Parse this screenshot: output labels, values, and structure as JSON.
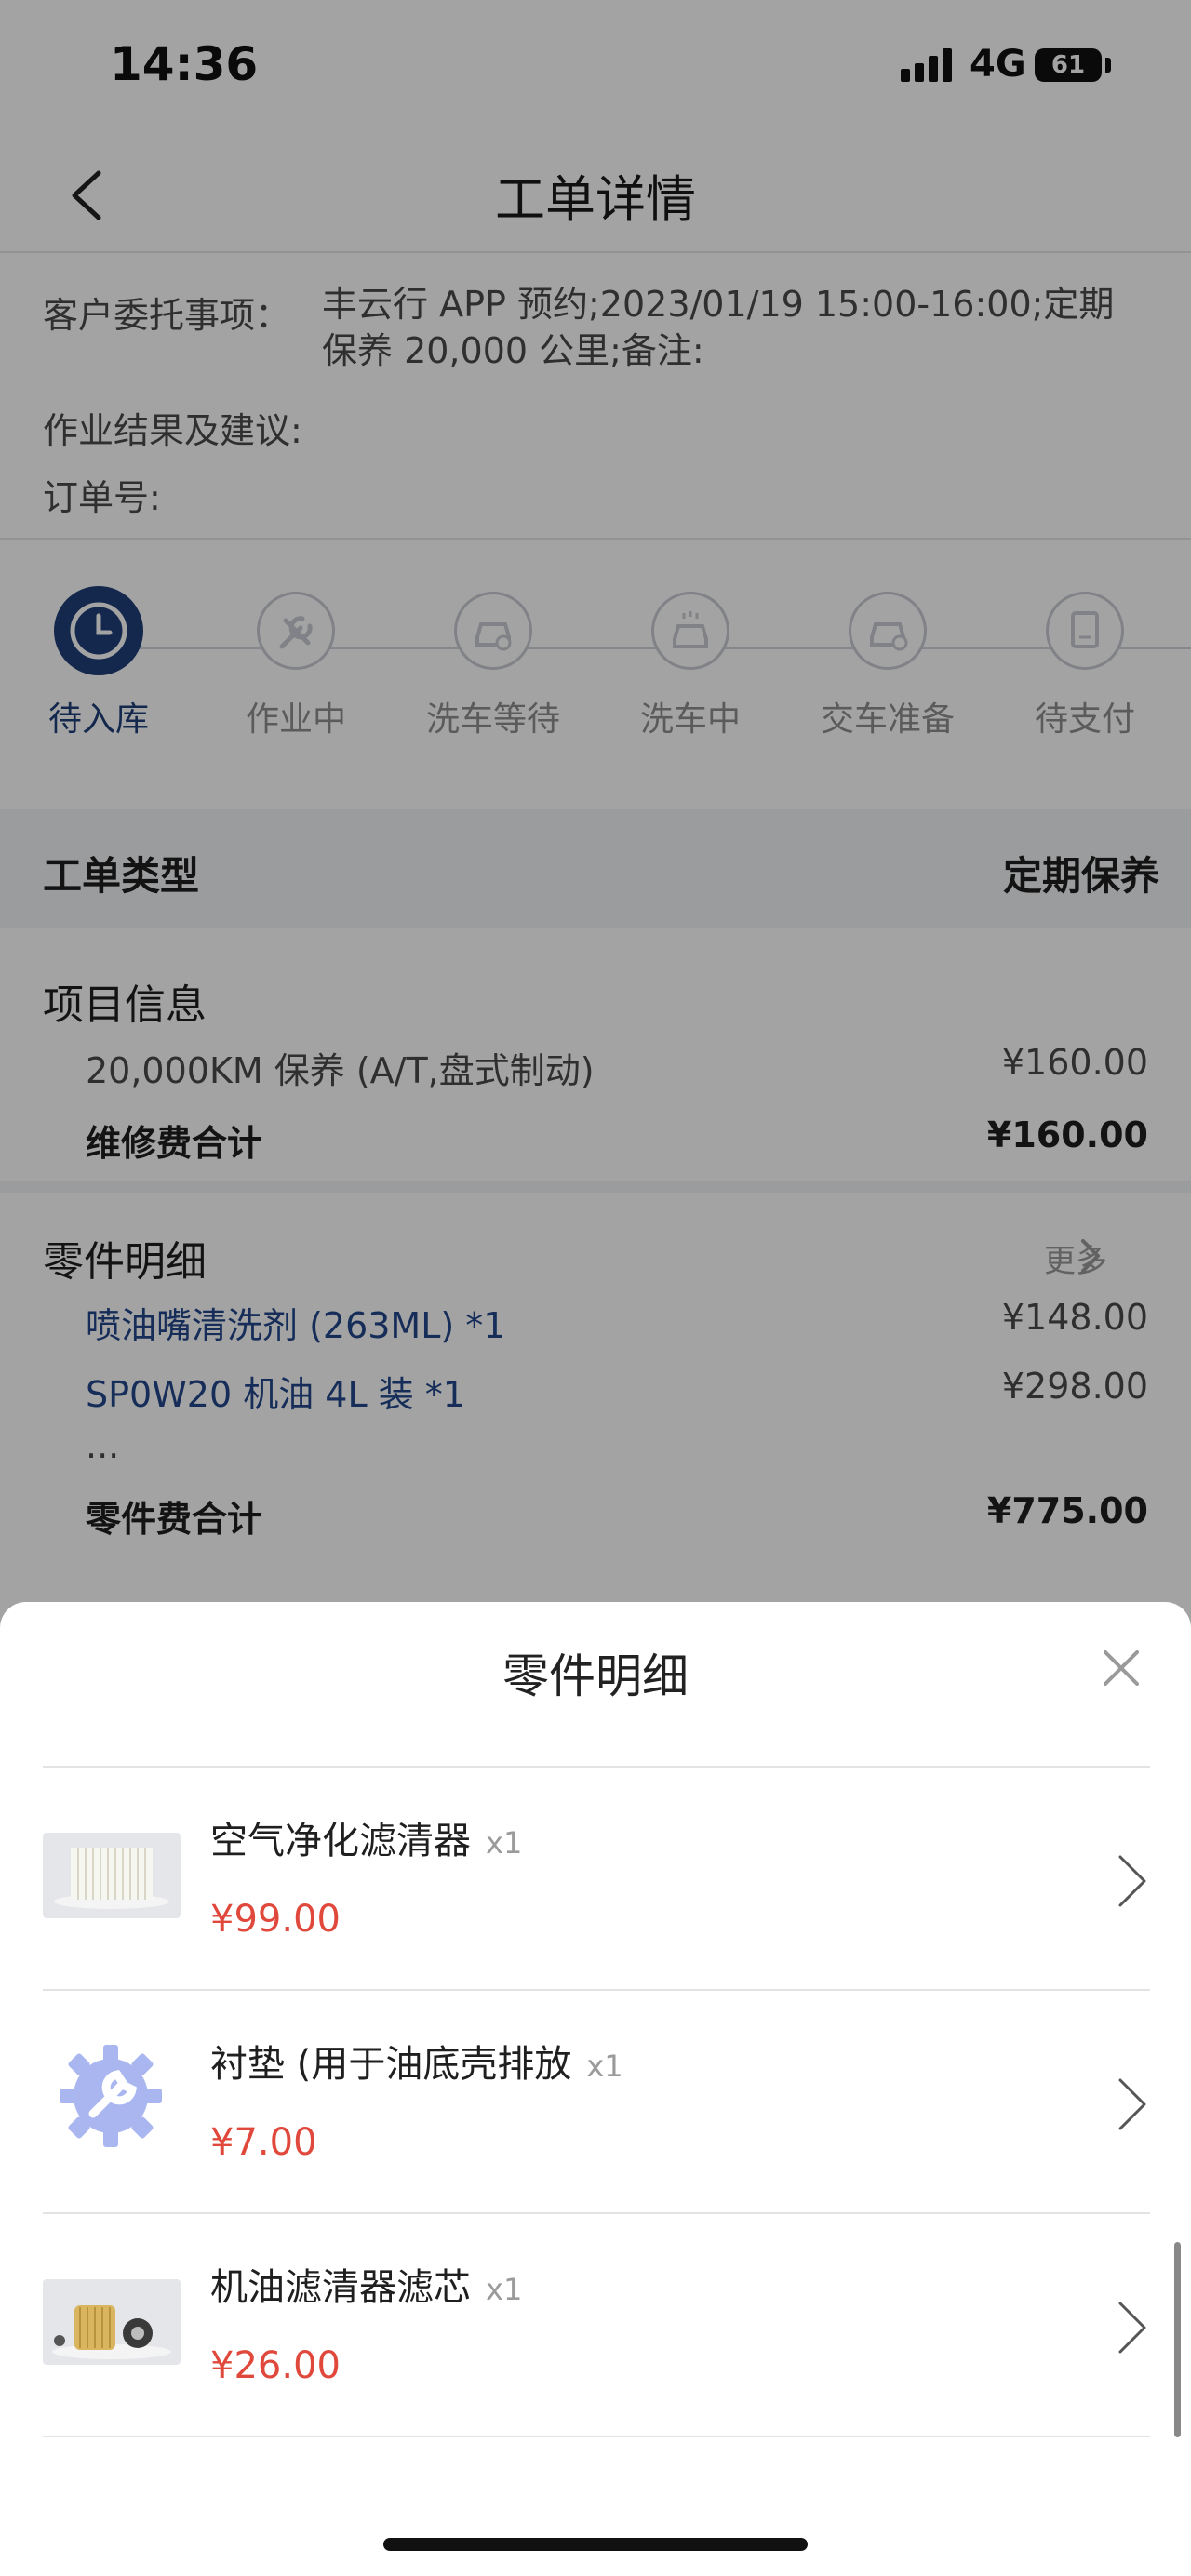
{
  "status_bar": {
    "time": "14:36",
    "network": "4G",
    "battery": "61"
  },
  "nav": {
    "title": "工单详情"
  },
  "info": {
    "commission_key": "客户委托事项：",
    "commission_value": "丰云行 APP 预约;2023/01/19 15:00-16:00;定期保养 20,000 公里;备注:",
    "result_key": "作业结果及建议:",
    "order_key": "订单号:"
  },
  "steps": [
    {
      "label": "待入库",
      "icon": "clock-icon",
      "active": true
    },
    {
      "label": "作业中",
      "icon": "wrench-icon",
      "active": false
    },
    {
      "label": "洗车等待",
      "icon": "car-wash-wait-icon",
      "active": false
    },
    {
      "label": "洗车中",
      "icon": "car-washing-icon",
      "active": false
    },
    {
      "label": "交车准备",
      "icon": "car-handover-icon",
      "active": false
    },
    {
      "label": "待支付",
      "icon": "payment-icon",
      "active": false
    }
  ],
  "work_type": {
    "label": "工单类型",
    "value": "定期保养"
  },
  "project": {
    "title": "项目信息",
    "items": [
      {
        "name": "20,000KM 保养 (A/T,盘式制动)",
        "price": "¥160.00"
      }
    ],
    "total_label": "维修费合计",
    "total_value": "¥160.00"
  },
  "parts_summary": {
    "title": "零件明细",
    "more": "更多",
    "items": [
      {
        "name": "喷油嘴清洗剂 (263ML) *1",
        "price": "¥148.00"
      },
      {
        "name": "SP0W20 机油 4L 装 *1",
        "price": "¥298.00"
      }
    ],
    "ellipsis": "...",
    "total_label": "零件费合计",
    "total_value": "¥775.00"
  },
  "sheet": {
    "title": "零件明细",
    "parts": [
      {
        "name": "空气净化滤清器",
        "qty": "x1",
        "price": "¥99.00",
        "image": "air-filter-image"
      },
      {
        "name": "衬垫 (用于油底壳排放",
        "qty": "x1",
        "price": "¥7.00",
        "image": "gear-wrench-placeholder-image"
      },
      {
        "name": "机油滤清器滤芯",
        "qty": "x1",
        "price": "¥26.00",
        "image": "oil-filter-image"
      }
    ]
  },
  "colors": {
    "accent": "#1f3f78",
    "link": "#22478a",
    "price": "#e0483c",
    "overlay": "rgba(0,0,0,0.36)"
  }
}
